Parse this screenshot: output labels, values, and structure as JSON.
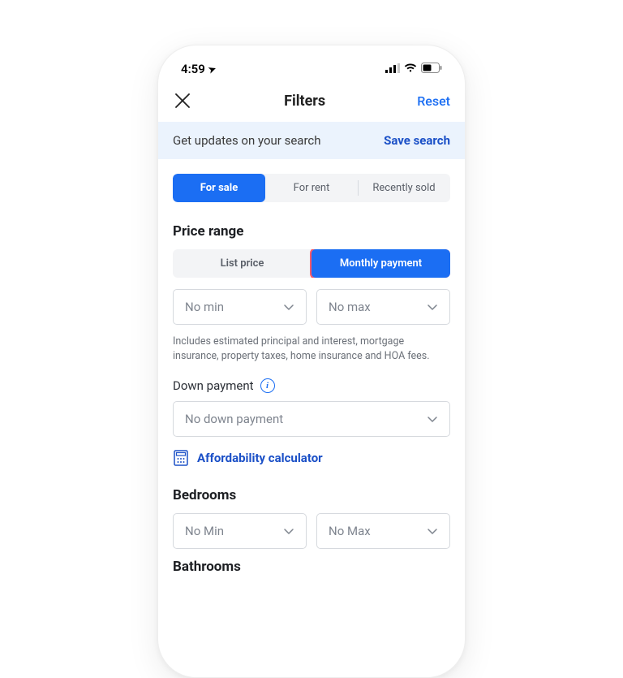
{
  "status": {
    "time": "4:59",
    "signal_icon": "signal-icon",
    "wifi_icon": "wifi-icon",
    "battery_icon": "battery-icon"
  },
  "header": {
    "title": "Filters",
    "reset_label": "Reset"
  },
  "banner": {
    "text": "Get updates on your search",
    "action": "Save search"
  },
  "listing_type_tabs": [
    {
      "label": "For sale",
      "active": true
    },
    {
      "label": "For rent",
      "active": false
    },
    {
      "label": "Recently sold",
      "active": false
    }
  ],
  "price": {
    "section_title": "Price range",
    "mode_tabs": [
      {
        "label": "List price",
        "active": false
      },
      {
        "label": "Monthly payment",
        "active": true
      }
    ],
    "min_value": "No min",
    "max_value": "No max",
    "fine_print": "Includes estimated principal and interest, mortgage insurance, property taxes, home insurance and HOA fees."
  },
  "down_payment": {
    "label": "Down payment",
    "value": "No down payment"
  },
  "affordability": {
    "link_label": "Affordability calculator"
  },
  "bedrooms": {
    "title": "Bedrooms",
    "min_value": "No Min",
    "max_value": "No Max"
  },
  "bathrooms": {
    "title": "Bathrooms"
  }
}
